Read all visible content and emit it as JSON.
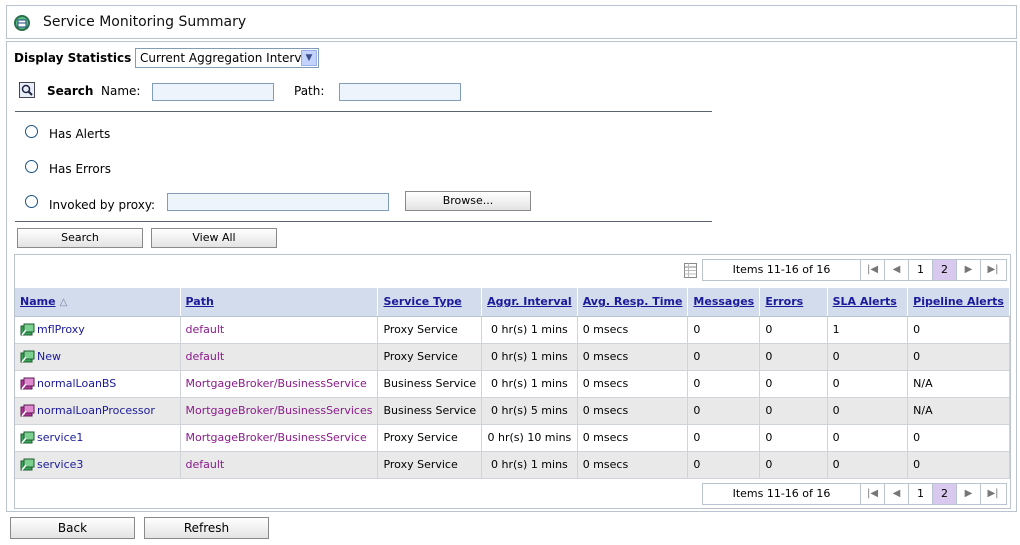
{
  "header": {
    "title": "Service Monitoring Summary",
    "icon": "monitor-icon"
  },
  "display": {
    "label": "Display Statistics",
    "selected": "Current Aggregation Interval"
  },
  "search": {
    "label": "Search",
    "name_label": "Name:",
    "name_value": "",
    "path_label": "Path:",
    "path_value": ""
  },
  "filters": {
    "has_alerts": "Has Alerts",
    "has_errors": "Has Errors",
    "invoked_by_proxy": "Invoked by proxy:",
    "proxy_value": "",
    "browse": "Browse..."
  },
  "actions": {
    "search": "Search",
    "view_all": "View All"
  },
  "pager": {
    "items_text": "Items 11-16 of 16",
    "pages": [
      "1",
      "2"
    ],
    "current_page": "2"
  },
  "table": {
    "columns": [
      "Name",
      "Path",
      "Service Type",
      "Aggr. Interval",
      "Avg. Resp. Time",
      "Messages",
      "Errors",
      "SLA Alerts",
      "Pipeline Alerts"
    ],
    "rows": [
      {
        "name": "mflProxy",
        "path": "default",
        "type": "Proxy Service",
        "interval": "0 hr(s) 1 mins",
        "resp": "0 msecs",
        "messages": "0",
        "errors": "0",
        "sla": "1",
        "pipeline": "0",
        "kind": "proxy"
      },
      {
        "name": "New",
        "path": "default",
        "type": "Proxy Service",
        "interval": "0 hr(s) 1 mins",
        "resp": "0 msecs",
        "messages": "0",
        "errors": "0",
        "sla": "0",
        "pipeline": "0",
        "kind": "proxy"
      },
      {
        "name": "normalLoanBS",
        "path": "MortgageBroker/BusinessService",
        "type": "Business Service",
        "interval": "0 hr(s) 1 mins",
        "resp": "0 msecs",
        "messages": "0",
        "errors": "0",
        "sla": "0",
        "pipeline": "N/A",
        "kind": "business"
      },
      {
        "name": "normalLoanProcessor",
        "path": "MortgageBroker/BusinessServices",
        "type": "Business Service",
        "interval": "0 hr(s) 5 mins",
        "resp": "0 msecs",
        "messages": "0",
        "errors": "0",
        "sla": "0",
        "pipeline": "N/A",
        "kind": "business"
      },
      {
        "name": "service1",
        "path": "MortgageBroker/BusinessService",
        "type": "Proxy Service",
        "interval": "0 hr(s) 10 mins",
        "resp": "0 msecs",
        "messages": "0",
        "errors": "0",
        "sla": "0",
        "pipeline": "0",
        "kind": "proxy"
      },
      {
        "name": "service3",
        "path": "default",
        "type": "Proxy Service",
        "interval": "0 hr(s) 1 mins",
        "resp": "0 msecs",
        "messages": "0",
        "errors": "0",
        "sla": "0",
        "pipeline": "0",
        "kind": "proxy"
      }
    ]
  },
  "footer": {
    "back": "Back",
    "refresh": "Refresh"
  },
  "colors": {
    "header_bg": "#d3dcec",
    "link": "#1a1a9a",
    "path_link": "#8a1a8a",
    "active_page": "#d9c9ee"
  }
}
